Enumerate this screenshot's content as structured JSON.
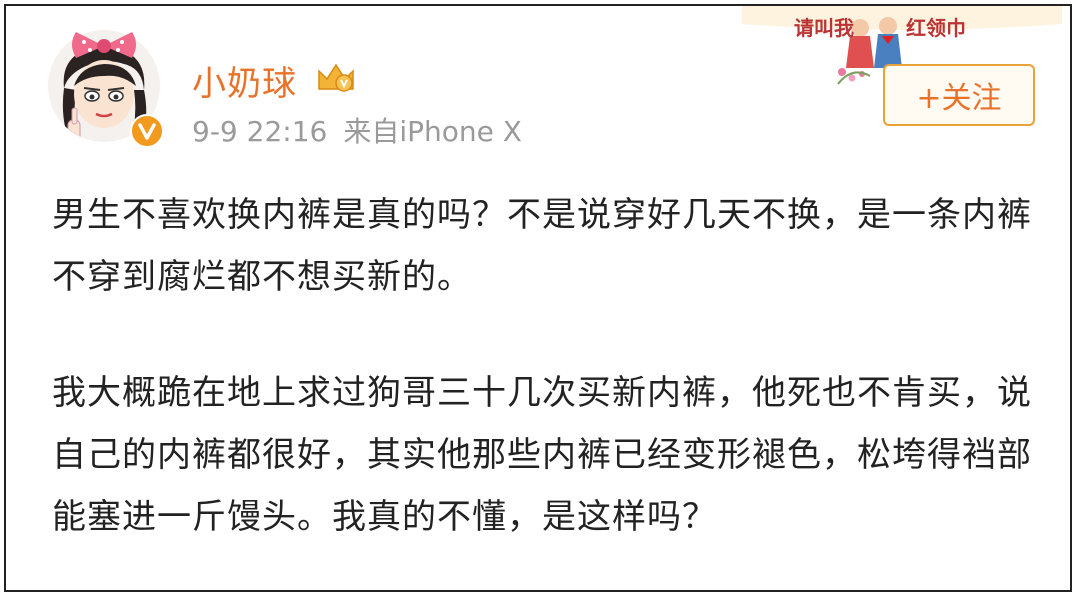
{
  "post": {
    "username": "小奶球",
    "time": "9-9 22:16",
    "source": "来自iPhone X",
    "follow_label": "+关注",
    "paragraphs": [
      "男生不喜欢换内裤是真的吗？不是说穿好几天不换，是一条内裤不穿到腐烂都不想买新的。",
      "我大概跪在地上求过狗哥三十几次买新内裤，他死也不肯买，说自己的内裤都很好，其实他那些内裤已经变形褪色，松垮得裆部能塞进一斤馒头。我真的不懂，是这样吗？"
    ]
  },
  "banner": {
    "left_text": "请叫我",
    "right_text": "红领巾"
  },
  "colors": {
    "username": "#e8722a",
    "meta": "#9a9a9a",
    "text": "#222222",
    "button_border": "#e8a23a"
  },
  "icons": [
    "avatar",
    "vip-crown-icon",
    "verified-badge-icon"
  ]
}
